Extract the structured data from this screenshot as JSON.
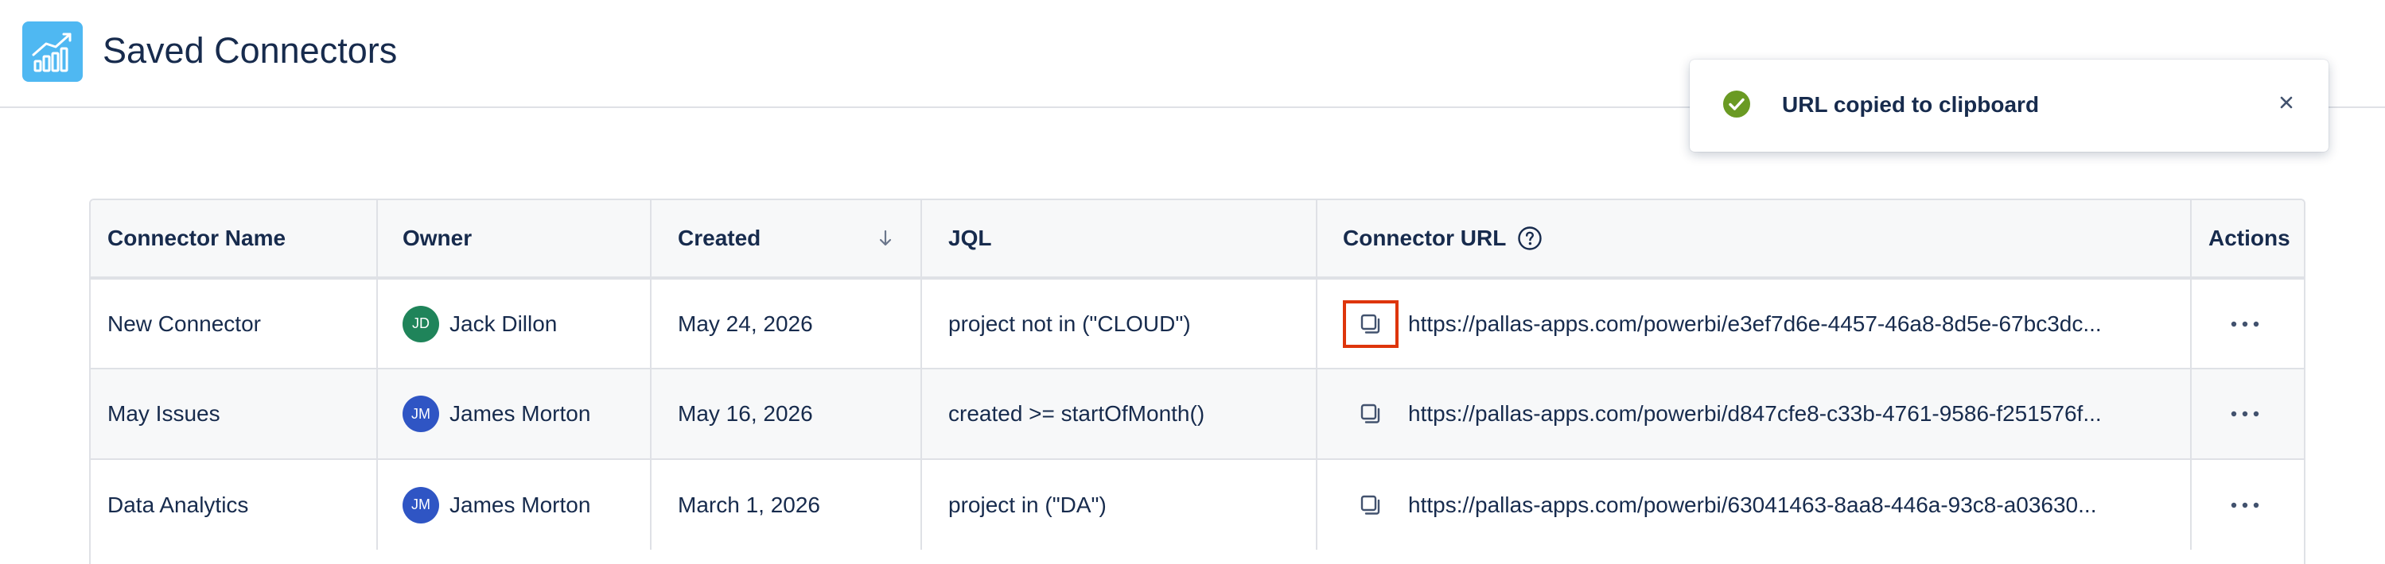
{
  "header": {
    "title": "Saved Connectors",
    "logo_icon": "bar-chart-trend-icon"
  },
  "toast": {
    "message": "URL copied to clipboard",
    "status_icon": "check-circle-icon",
    "close_icon": "close-icon"
  },
  "table": {
    "columns": {
      "name": "Connector Name",
      "owner": "Owner",
      "created": "Created",
      "jql": "JQL",
      "url": "Connector URL",
      "actions": "Actions"
    },
    "rows": [
      {
        "name": "New Connector",
        "owner_initials": "JD",
        "owner_name": "Jack Dillon",
        "avatar_color": "#1f845a",
        "created": "May 24, 2026",
        "jql": "project not in (\"CLOUD\")",
        "url": "https://pallas-apps.com/powerbi/e3ef7d6e-4457-46a8-8d5e-67bc3dc...",
        "copy_focused": true
      },
      {
        "name": "May Issues",
        "owner_initials": "JM",
        "owner_name": "James Morton",
        "avatar_color": "#2f55c4",
        "created": "May 16, 2026",
        "jql": "created >= startOfMonth()",
        "url": "https://pallas-apps.com/powerbi/d847cfe8-c33b-4761-9586-f251576f...",
        "copy_focused": false
      },
      {
        "name": "Data Analytics",
        "owner_initials": "JM",
        "owner_name": "James Morton",
        "avatar_color": "#2f55c4",
        "created": "March 1, 2026",
        "jql": "project in (\"DA\")",
        "url": "https://pallas-apps.com/powerbi/63041463-8aa8-446a-93c8-a03630...",
        "copy_focused": false
      }
    ]
  },
  "colors": {
    "accent_logo": "#4fb8f2",
    "success": "#6a9a23",
    "focus_ring": "#de350b",
    "border": "#dfe1e6",
    "text": "#172b4d"
  }
}
